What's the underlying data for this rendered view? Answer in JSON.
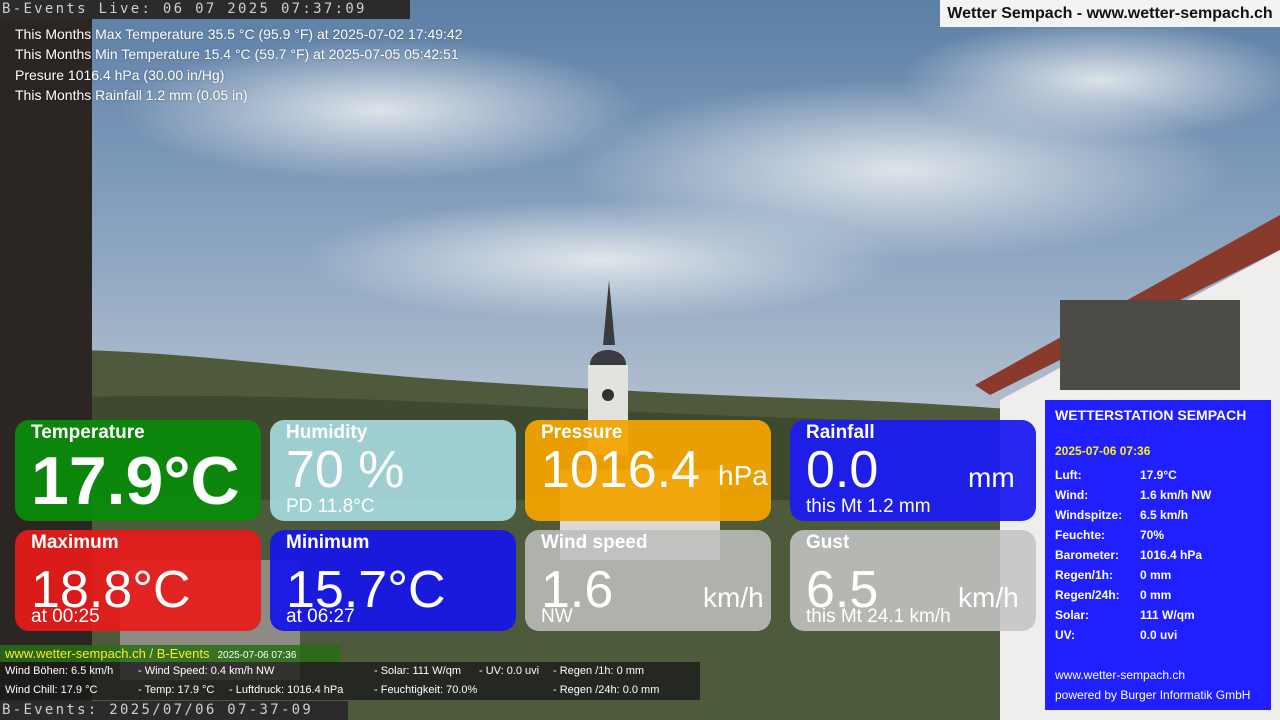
{
  "overlay": {
    "live_top": "B-Events Live: 06 07 2025 07:37:09",
    "brand": "Wetter Sempach - www.wetter-sempach.ch",
    "stats": [
      "This Months Max Temperature 35.5 °C (95.9 °F) at 2025-07-02 17:49:42",
      "This Months Min Temperature 15.4 °C (59.7 °F) at 2025-07-05 05:42:51",
      "Presure 1016.4 hPa (30.00 in/Hg)",
      "This Months Rainfall 1.2 mm (0.05 in)"
    ]
  },
  "tiles": {
    "temperature": {
      "title": "Temperature",
      "value": "17.9°C",
      "color": "#0a8a0a"
    },
    "humidity": {
      "title": "Humidity",
      "value": "70 %",
      "sub": "PD 11.8°C",
      "color": "#a9dde2"
    },
    "pressure": {
      "title": "Pressure",
      "value": "1016.4",
      "unit": "hPa",
      "color": "#f2a300"
    },
    "rainfall": {
      "title": "Rainfall",
      "value": "0.0",
      "unit": "mm",
      "sub": "this Mt 1.2 mm",
      "color": "#1b1bf0"
    },
    "maximum": {
      "title": "Maximum",
      "value": "18.8°C",
      "sub": "at 00:25",
      "color": "#e81a1a"
    },
    "minimum": {
      "title": "Minimum",
      "value": "15.7°C",
      "sub": "at 06:27",
      "color": "#1717e6"
    },
    "windspeed": {
      "title": "Wind speed",
      "value": "1.6",
      "unit": "km/h",
      "sub": "NW",
      "color": "#bdbdbd"
    },
    "gust": {
      "title": "Gust",
      "value": "6.5",
      "unit": "km/h",
      "sub": "this Mt 24.1 km/h",
      "color": "#c4c4c4"
    }
  },
  "footer": {
    "link": "www.wetter-sempach.ch / B-Events",
    "timestamp": "2025-07-06 07:36",
    "row1": [
      "Wind Böhen: 6.5 km/h",
      "- Wind Speed: 0.4 km/h NW",
      "- Solar: 111 W/qm",
      "- UV: 0.0 uvi",
      "- Regen /1h:   0 mm"
    ],
    "row2": [
      "Wind Chill: 17.9 °C",
      "- Temp: 17.9 °C",
      "- Luftdruck: 1016.4 hPa",
      "- Feuchtigkeit: 70.0%",
      "- Regen /24h: 0.0 mm"
    ],
    "live_bottom": "B-Events: 2025/07/06 07-37-09"
  },
  "station": {
    "heading": "WETTERSTATION SEMPACH",
    "date": "2025-07-06 07:36",
    "rows": [
      {
        "label": "Luft:",
        "value": "17.9°C"
      },
      {
        "label": "Wind:",
        "value": "1.6 km/h  NW"
      },
      {
        "label": "Windspitze:",
        "value": "6.5 km/h"
      },
      {
        "label": "Feuchte:",
        "value": "70%"
      },
      {
        "label": "Barometer:",
        "value": "1016.4 hPa"
      },
      {
        "label": "Regen/1h:",
        "value": "0 mm"
      },
      {
        "label": "Regen/24h:",
        "value": "0 mm"
      },
      {
        "label": "Solar:",
        "value": "111 W/qm"
      },
      {
        "label": "UV:",
        "value": "0.0 uvi"
      }
    ],
    "site": "www.wetter-sempach.ch",
    "powered": "powered by Burger Informatik GmbH"
  }
}
